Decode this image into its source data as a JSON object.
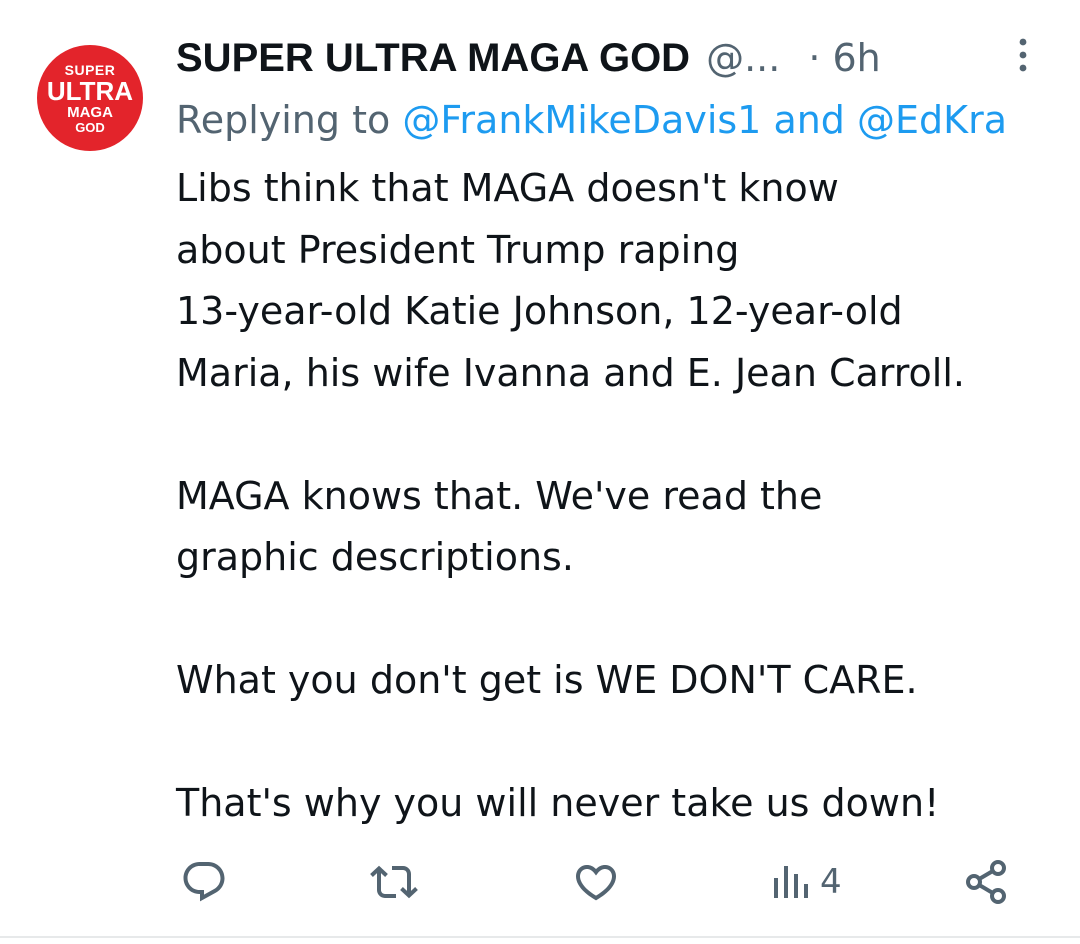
{
  "tweet": {
    "author": {
      "display_name": "SUPER ULTRA MAGA GOD",
      "handle": "@...",
      "avatar_text": [
        "SUPER",
        "ULTRA",
        "MAGA",
        "GOD"
      ],
      "avatar_color": "#e3242b"
    },
    "time": "· 6h",
    "reply": {
      "prefix": "Replying to ",
      "mention_1": "@FrankMikeDavis1",
      "joiner": " and ",
      "mention_2": "@EdKra"
    },
    "body": {
      "line_1": "Libs think that MAGA doesn't know",
      "line_2": "about President Trump raping",
      "line_3": "13-year-old Katie Johnson, 12-year-old",
      "line_4": "Maria, his wife Ivanna and E. Jean Carroll.",
      "line_5": "MAGA knows that. We've read the",
      "line_6": "graphic descriptions.",
      "line_7": "What you don't get is WE DON'T CARE.",
      "line_8": "That's why you will never take us down!"
    },
    "actions": {
      "views": "4",
      "icons": [
        "reply-icon",
        "retweet-icon",
        "like-icon",
        "views-icon",
        "share-icon"
      ]
    }
  },
  "colors": {
    "text": "#0f1419",
    "secondary": "#536471",
    "link": "#1d9bf0",
    "divider": "#e7e9ea"
  }
}
